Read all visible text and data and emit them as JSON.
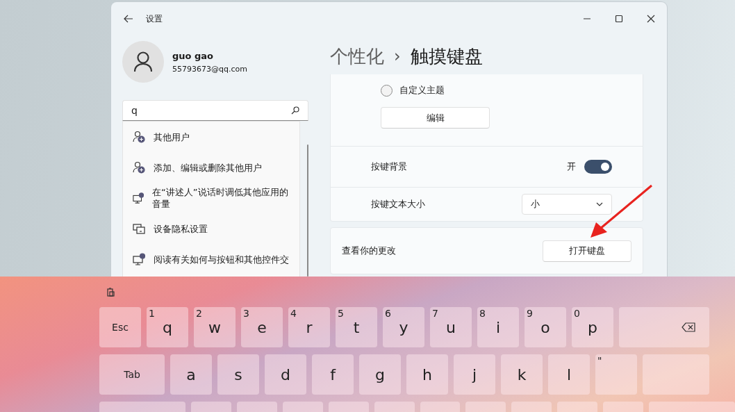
{
  "window": {
    "title": "设置"
  },
  "account": {
    "name": "guo gao",
    "email": "55793673@qq.com"
  },
  "search": {
    "value": "q",
    "suggestions": [
      {
        "kind": "user",
        "label": "其他用户"
      },
      {
        "kind": "user",
        "label": "添加、编辑或删除其他用户"
      },
      {
        "kind": "narrator",
        "label": "在“讲述人”说话时调低其他应用的音量"
      },
      {
        "kind": "devices",
        "label": "设备隐私设置"
      },
      {
        "kind": "narrator",
        "label": "阅读有关如何与按钮和其他控件交"
      }
    ]
  },
  "breadcrumb": {
    "parent": "个性化",
    "separator": "›",
    "current": "触摸键盘"
  },
  "theme_card": {
    "radio": {
      "label": "自定义主题",
      "selected": false
    },
    "edit_button": "编辑",
    "rows": [
      {
        "kind": "toggle",
        "label": "按键背景",
        "state_label": "开",
        "on": true
      },
      {
        "kind": "dropdown",
        "label": "按键文本大小",
        "value": "小"
      }
    ]
  },
  "preview_card": {
    "label": "查看你的更改",
    "button": "打开键盘"
  },
  "keyboard": {
    "rows": [
      [
        {
          "kind": "text",
          "label": "Esc"
        },
        {
          "kind": "letter",
          "label": "q",
          "hint": "1"
        },
        {
          "kind": "letter",
          "label": "w",
          "hint": "2"
        },
        {
          "kind": "letter",
          "label": "e",
          "hint": "3"
        },
        {
          "kind": "letter",
          "label": "r",
          "hint": "4"
        },
        {
          "kind": "letter",
          "label": "t",
          "hint": "5"
        },
        {
          "kind": "letter",
          "label": "y",
          "hint": "6"
        },
        {
          "kind": "letter",
          "label": "u",
          "hint": "7"
        },
        {
          "kind": "letter",
          "label": "i",
          "hint": "8"
        },
        {
          "kind": "letter",
          "label": "o",
          "hint": "9"
        },
        {
          "kind": "letter",
          "label": "p",
          "hint": "0"
        },
        {
          "kind": "backspace"
        }
      ],
      [
        {
          "kind": "tab",
          "label": "Tab"
        },
        {
          "kind": "letter",
          "label": "a"
        },
        {
          "kind": "letter",
          "label": "s"
        },
        {
          "kind": "letter",
          "label": "d"
        },
        {
          "kind": "letter",
          "label": "f"
        },
        {
          "kind": "letter",
          "label": "g"
        },
        {
          "kind": "letter",
          "label": "h"
        },
        {
          "kind": "letter",
          "label": "j"
        },
        {
          "kind": "letter",
          "label": "k"
        },
        {
          "kind": "letter",
          "label": "l"
        },
        {
          "kind": "letter",
          "hint": "\""
        },
        {
          "kind": "enter"
        }
      ],
      [
        {
          "kind": "shift"
        },
        {
          "kind": "blank"
        },
        {
          "kind": "blank"
        },
        {
          "kind": "blank"
        },
        {
          "kind": "blank"
        },
        {
          "kind": "blank"
        },
        {
          "kind": "blank"
        },
        {
          "kind": "blank"
        },
        {
          "kind": "blank"
        },
        {
          "kind": "blank"
        },
        {
          "kind": "blank"
        },
        {
          "kind": "shift"
        }
      ]
    ]
  }
}
